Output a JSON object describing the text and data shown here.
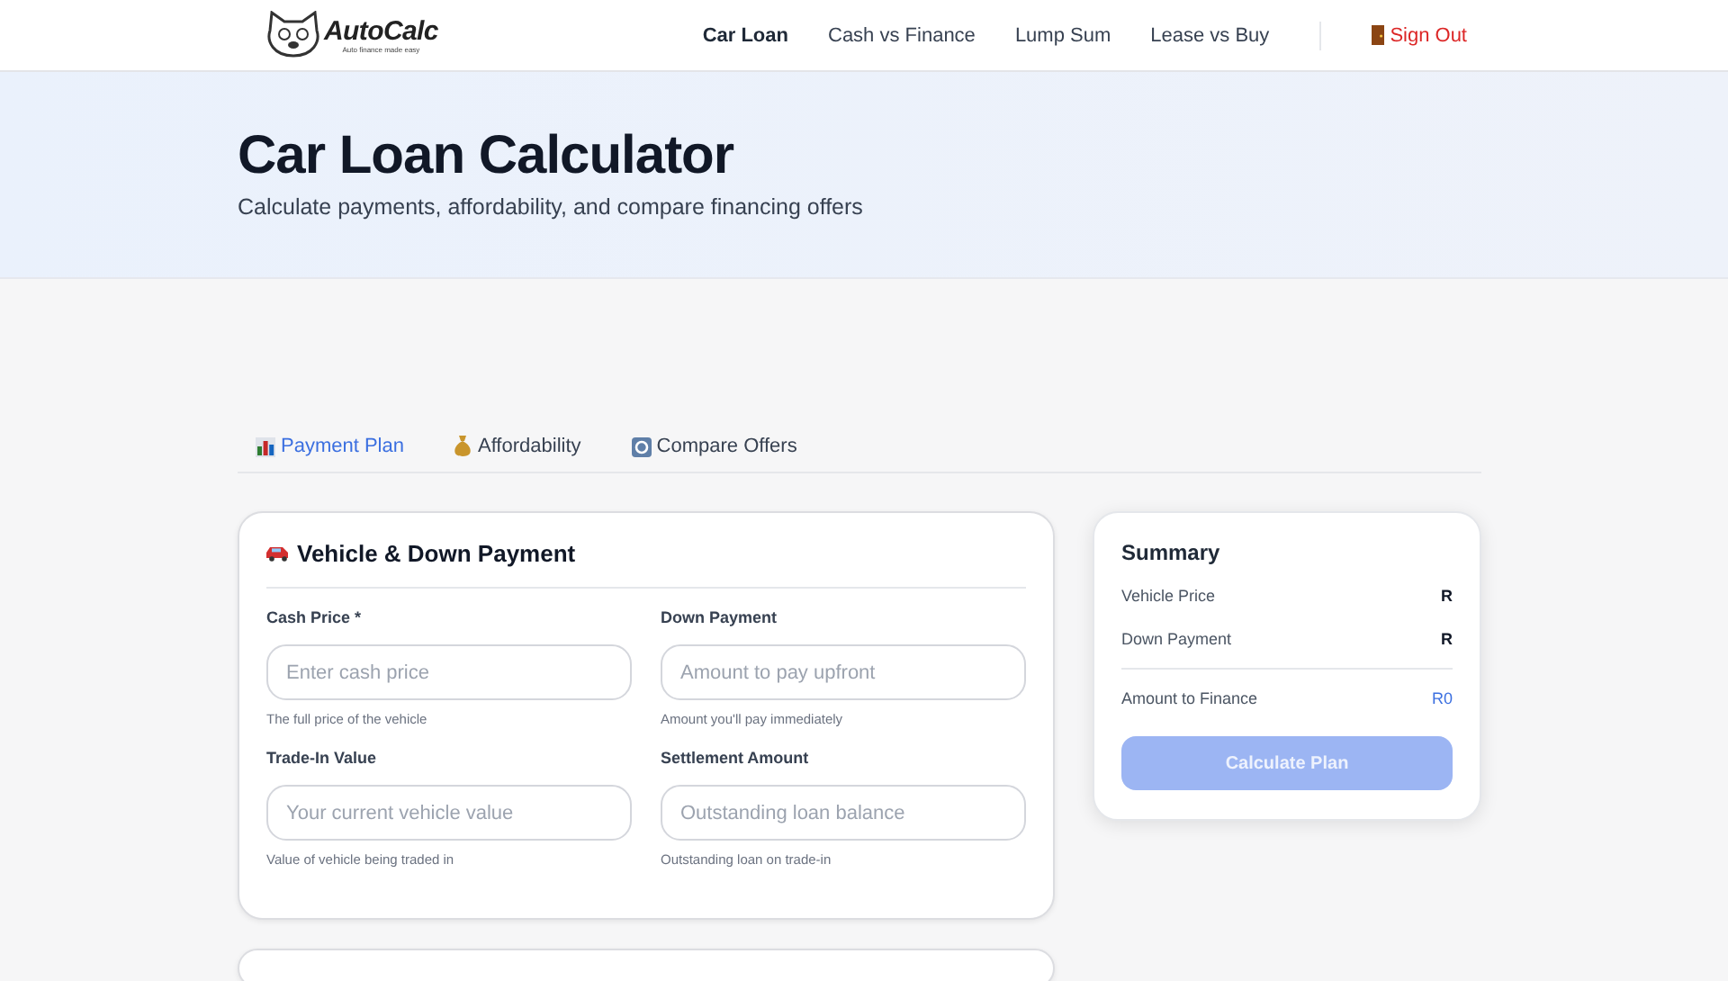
{
  "header": {
    "logo": {
      "name": "AutoCalc",
      "tagline": "Auto finance made easy"
    },
    "nav": [
      {
        "label": "Car Loan",
        "selected": true
      },
      {
        "label": "Cash vs Finance",
        "selected": false
      },
      {
        "label": "Lump Sum",
        "selected": false
      },
      {
        "label": "Lease vs Buy",
        "selected": false
      }
    ],
    "sign_out": "Sign Out"
  },
  "hero": {
    "title": "Car Loan Calculator",
    "subtitle": "Calculate payments, affordability, and compare financing offers"
  },
  "tabs": [
    {
      "label": "Payment Plan",
      "selected": true
    },
    {
      "label": "Affordability",
      "selected": false
    },
    {
      "label": "Compare Offers",
      "selected": false
    }
  ],
  "vehicle_card": {
    "title": "Vehicle & Down Payment",
    "fields": [
      {
        "label": "Cash Price *",
        "placeholder": "Enter cash price",
        "hint": "The full price of the vehicle"
      },
      {
        "label": "Down Payment",
        "placeholder": "Amount to pay upfront",
        "hint": "Amount you'll pay immediately"
      },
      {
        "label": "Trade-In Value",
        "placeholder": "Your current vehicle value",
        "hint": "Value of vehicle being traded in"
      },
      {
        "label": "Settlement Amount",
        "placeholder": "Outstanding loan balance",
        "hint": "Outstanding loan on trade-in"
      }
    ]
  },
  "summary": {
    "title": "Summary",
    "rows": [
      {
        "label": "Vehicle Price",
        "value": "R"
      },
      {
        "label": "Down Payment",
        "value": "R"
      }
    ],
    "total": {
      "label": "Amount to Finance",
      "value": "R0"
    },
    "button": {
      "label": "Calculate Plan",
      "disabled": true
    }
  }
}
